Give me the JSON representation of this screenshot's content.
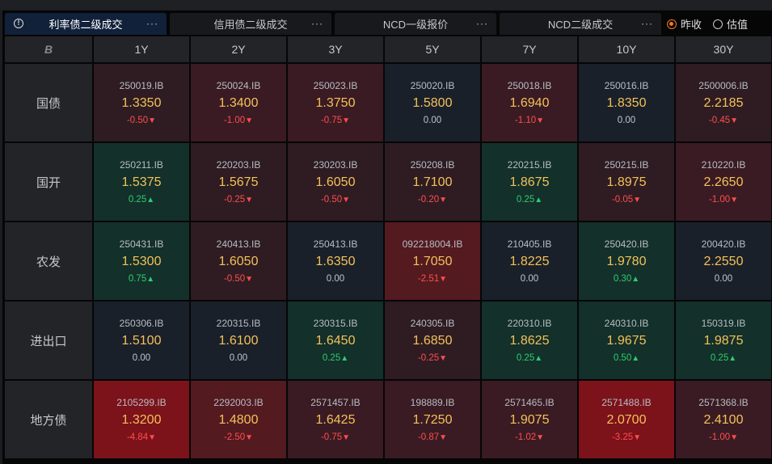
{
  "tabs": [
    {
      "label": "利率债二级成交",
      "active": true
    },
    {
      "label": "信用债二级成交",
      "active": false
    },
    {
      "label": "NCD一级报价",
      "active": false
    },
    {
      "label": "NCD二级成交",
      "active": false
    }
  ],
  "more_label": "···",
  "info_icon": "!",
  "radios": [
    {
      "label": "昨收",
      "checked": true
    },
    {
      "label": "估值",
      "checked": false
    }
  ],
  "corner_logo": "B",
  "tenors": [
    "1Y",
    "2Y",
    "3Y",
    "5Y",
    "7Y",
    "10Y",
    "30Y"
  ],
  "colors": {
    "down": "#ff4d4f",
    "up": "#2ecc71",
    "flat": "#c0c4cc",
    "yield": "#f4c15a"
  },
  "rows": [
    {
      "label": "国债",
      "cells": [
        {
          "code": "250019.IB",
          "yield": "1.3350",
          "change": "-0.50"
        },
        {
          "code": "250024.IB",
          "yield": "1.3400",
          "change": "-1.00"
        },
        {
          "code": "250023.IB",
          "yield": "1.3750",
          "change": "-0.75"
        },
        {
          "code": "250020.IB",
          "yield": "1.5800",
          "change": "0.00"
        },
        {
          "code": "250018.IB",
          "yield": "1.6940",
          "change": "-1.10"
        },
        {
          "code": "250016.IB",
          "yield": "1.8350",
          "change": "0.00"
        },
        {
          "code": "2500006.IB",
          "yield": "2.2185",
          "change": "-0.45"
        }
      ]
    },
    {
      "label": "国开",
      "cells": [
        {
          "code": "250211.IB",
          "yield": "1.5375",
          "change": "0.25"
        },
        {
          "code": "220203.IB",
          "yield": "1.5675",
          "change": "-0.25"
        },
        {
          "code": "230203.IB",
          "yield": "1.6050",
          "change": "-0.50"
        },
        {
          "code": "250208.IB",
          "yield": "1.7100",
          "change": "-0.20"
        },
        {
          "code": "220215.IB",
          "yield": "1.8675",
          "change": "0.25"
        },
        {
          "code": "250215.IB",
          "yield": "1.8975",
          "change": "-0.05"
        },
        {
          "code": "210220.IB",
          "yield": "2.2650",
          "change": "-1.00"
        }
      ]
    },
    {
      "label": "农发",
      "cells": [
        {
          "code": "250431.IB",
          "yield": "1.5300",
          "change": "0.75"
        },
        {
          "code": "240413.IB",
          "yield": "1.6050",
          "change": "-0.50"
        },
        {
          "code": "250413.IB",
          "yield": "1.6350",
          "change": "0.00"
        },
        {
          "code": "092218004.IB",
          "yield": "1.7050",
          "change": "-2.51"
        },
        {
          "code": "210405.IB",
          "yield": "1.8225",
          "change": "0.00"
        },
        {
          "code": "250420.IB",
          "yield": "1.9780",
          "change": "0.30"
        },
        {
          "code": "200420.IB",
          "yield": "2.2550",
          "change": "0.00"
        }
      ]
    },
    {
      "label": "进出口",
      "cells": [
        {
          "code": "250306.IB",
          "yield": "1.5100",
          "change": "0.00"
        },
        {
          "code": "220315.IB",
          "yield": "1.6100",
          "change": "0.00"
        },
        {
          "code": "230315.IB",
          "yield": "1.6450",
          "change": "0.25"
        },
        {
          "code": "240305.IB",
          "yield": "1.6850",
          "change": "-0.25"
        },
        {
          "code": "220310.IB",
          "yield": "1.8625",
          "change": "0.25"
        },
        {
          "code": "240310.IB",
          "yield": "1.9675",
          "change": "0.50"
        },
        {
          "code": "150319.IB",
          "yield": "1.9875",
          "change": "0.25"
        }
      ]
    },
    {
      "label": "地方债",
      "cells": [
        {
          "code": "2105299.IB",
          "yield": "1.3200",
          "change": "-4.84"
        },
        {
          "code": "2292003.IB",
          "yield": "1.4800",
          "change": "-2.50"
        },
        {
          "code": "2571457.IB",
          "yield": "1.6425",
          "change": "-0.75"
        },
        {
          "code": "198889.IB",
          "yield": "1.7250",
          "change": "-0.87"
        },
        {
          "code": "2571465.IB",
          "yield": "1.9075",
          "change": "-1.02"
        },
        {
          "code": "2571488.IB",
          "yield": "2.0700",
          "change": "-3.25"
        },
        {
          "code": "2571368.IB",
          "yield": "2.4100",
          "change": "-1.00"
        }
      ]
    }
  ]
}
